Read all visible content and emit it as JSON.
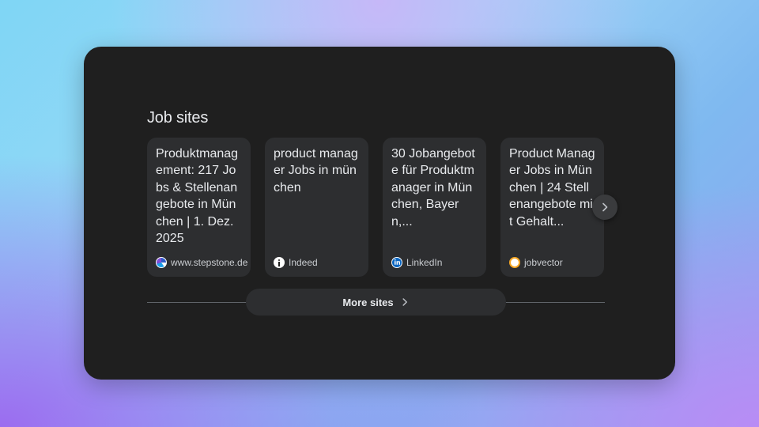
{
  "section": {
    "title": "Job sites"
  },
  "cards": [
    {
      "title": "Produktmanagement: 217 Jobs & Stellenangebote in München | 1. Dez. 2025",
      "source": "www.stepstone.de",
      "icon": "stepstone-favicon-icon"
    },
    {
      "title": "product manager Jobs in münchen",
      "source": "Indeed",
      "icon": "indeed-favicon-icon"
    },
    {
      "title": "30 Jobangebote für Produktmanager in München, Bayern,...",
      "source": "LinkedIn",
      "icon": "linkedin-favicon-icon"
    },
    {
      "title": "Product Manager Jobs in München | 24 Stellenangebote mit Gehalt...",
      "source": "jobvector",
      "icon": "jobvector-favicon-icon"
    }
  ],
  "carousel": {
    "next_icon": "chevron-right-icon"
  },
  "footer": {
    "more_label": "More sites",
    "more_icon": "chevron-right-icon"
  },
  "colors": {
    "panel_bg": "#1f1f1f",
    "card_bg": "#2d2e30",
    "text_primary": "#e8eaed",
    "text_secondary": "#c9ccd0",
    "linkedin_blue": "#0a66c2",
    "jobvector_orange": "#f5a623"
  }
}
